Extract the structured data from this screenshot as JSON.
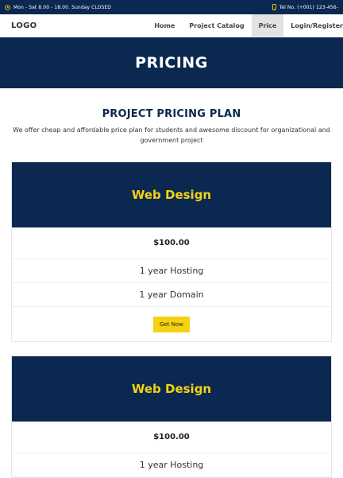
{
  "topbar": {
    "hours_icon": "clock-icon",
    "hours": "Mon - Sat 8.00 - 18.00. Sunday CLOSED",
    "phone_icon": "phone-icon",
    "phone": "Tel No. (+001) 123-456-"
  },
  "navbar": {
    "logo": "LOGO",
    "items": [
      {
        "label": "Home"
      },
      {
        "label": "Project Catalog"
      },
      {
        "label": "Price"
      },
      {
        "label": "Login/Register"
      }
    ]
  },
  "hero": {
    "title": "PRICING"
  },
  "intro": {
    "title": "PROJECT PRICING PLAN",
    "text": "We offer cheap and affordable price plan for students and awesome discount for organizational and government project"
  },
  "plans": [
    {
      "name": "Web Design",
      "price": "$100.00",
      "features": [
        "1 year Hosting",
        "1 year Domain"
      ],
      "button": "Get Now"
    },
    {
      "name": "Web Design",
      "price": "$100.00",
      "features": [
        "1 year Hosting"
      ]
    }
  ],
  "colors": {
    "navy": "#0a2850",
    "accent": "#f5d211"
  }
}
